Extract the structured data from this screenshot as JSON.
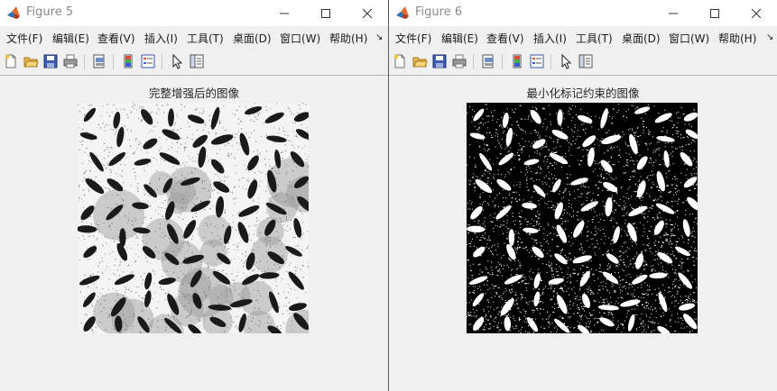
{
  "menu": [
    "文件(F)",
    "编辑(E)",
    "查看(V)",
    "插入(I)",
    "工具(T)",
    "桌面(D)",
    "窗口(W)",
    "帮助(H)"
  ],
  "menu_overflow": "↘",
  "windows": [
    {
      "title": "Figure 5",
      "axes_title": "完整增强后的图像",
      "image_style": "enhanced-grayscale-rice"
    },
    {
      "title": "Figure 6",
      "axes_title": "最小化标记约束的图像",
      "image_style": "binary-rice-markers"
    }
  ],
  "toolbar_icons": [
    "new-figure-icon",
    "open-file-icon",
    "save-icon",
    "print-icon",
    "print-preview-icon",
    "colorbar-icon",
    "legend-icon",
    "edit-plot-arrow-icon",
    "property-inspector-icon"
  ],
  "colors": {
    "titlebar": "#ffffff",
    "window_bg": "#f0f0f0",
    "image_dark": "#1a1a1a",
    "image_light": "#ffffff"
  }
}
